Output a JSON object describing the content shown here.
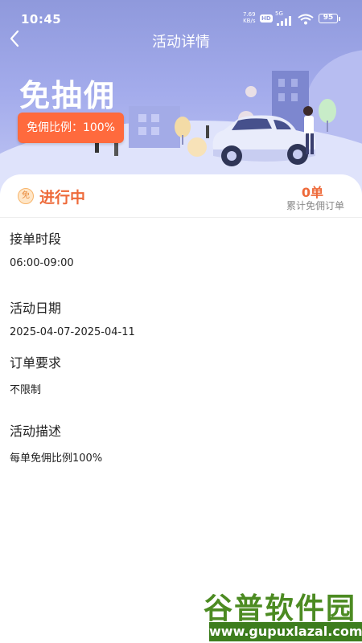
{
  "status_bar": {
    "time": "10:45",
    "speed_value": "7.69",
    "speed_unit": "KB/s",
    "hd": "HD",
    "network": "5G",
    "battery": "95"
  },
  "nav": {
    "title": "活动详情"
  },
  "promo": {
    "title": "免抽佣",
    "ratio_badge": "免佣比例：100%"
  },
  "status": {
    "coin_symbol": "免",
    "text": "进行中",
    "order_count": "0单",
    "order_label": "累计免佣订单"
  },
  "details": [
    {
      "label": "接单时段",
      "value": "06:00-09:00"
    },
    {
      "label": "活动日期",
      "value": "2025-04-07-2025-04-11"
    },
    {
      "label": "订单要求",
      "value": "不限制"
    },
    {
      "label": "活动描述",
      "value": "每单免佣比例100%"
    }
  ],
  "watermark": {
    "top": "谷普软件园",
    "bottom": "www.gupuxlazal.com"
  },
  "colors": {
    "accent": "#ee6a3a",
    "badge": "#ff6a3d",
    "hero": "#8f99dc"
  }
}
